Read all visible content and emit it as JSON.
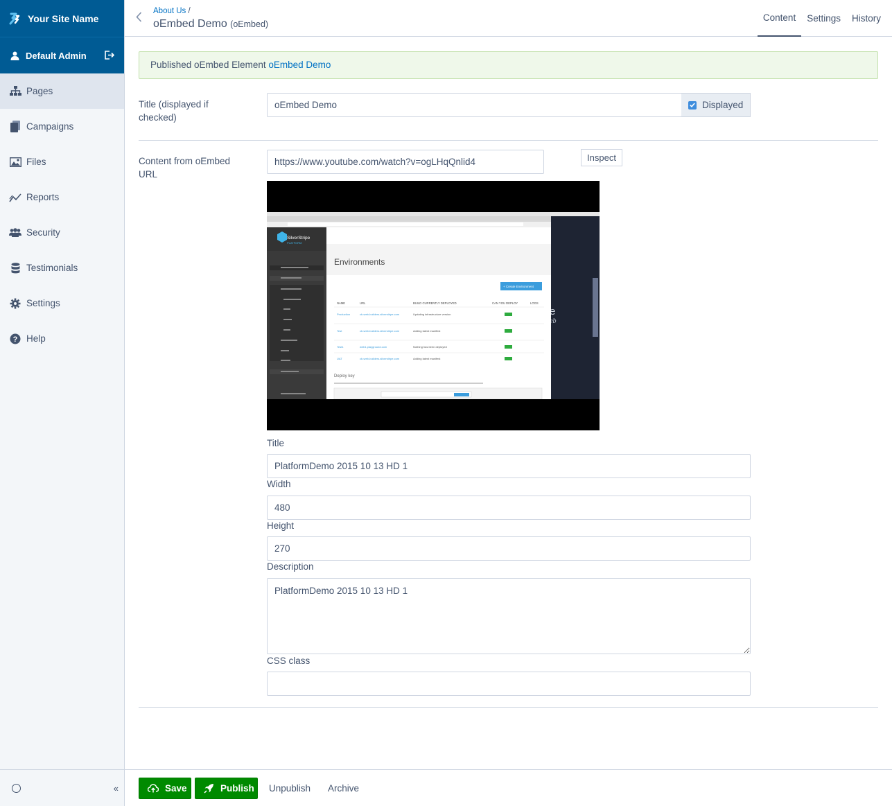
{
  "sidebar": {
    "brand": "Your Site Name",
    "user": "Default Admin",
    "items": [
      {
        "label": "Pages"
      },
      {
        "label": "Campaigns"
      },
      {
        "label": "Files"
      },
      {
        "label": "Reports"
      },
      {
        "label": "Security"
      },
      {
        "label": "Testimonials"
      },
      {
        "label": "Settings"
      },
      {
        "label": "Help"
      }
    ],
    "collapse_label": "«"
  },
  "header": {
    "breadcrumb": "About Us",
    "breadcrumb_sep": "/",
    "title": "oEmbed Demo",
    "type_label": "(oEmbed)",
    "tabs": [
      {
        "label": "Content"
      },
      {
        "label": "Settings"
      },
      {
        "label": "History"
      }
    ]
  },
  "message": {
    "text": "Published oEmbed Element",
    "link": "oEmbed Demo"
  },
  "form": {
    "title_label": "Title (displayed if checked)",
    "title_value": "oEmbed Demo",
    "displayed_label": "Displayed",
    "url_label": "Content from oEmbed URL",
    "url_value": "https://www.youtube.com/watch?v=ogLHqQnlid4",
    "inspect_label": "Inspect",
    "video": {
      "app_name": "SilverStripe",
      "app_sub": "PLATFORM",
      "heading": "Environments",
      "create_button": "+ Create Environment",
      "columns": [
        "NAME",
        "URL",
        "BUILD CURRENTLY DEPLOYED",
        "CAN YOU DEPLOY",
        "LOGS"
      ],
      "rows": [
        {
          "name": "Production",
          "url": "cb-web-builders.silverstripe.com",
          "build": "Updating infrastructure version"
        },
        {
          "name": "Test",
          "url": "cb-web-builders.silverstripe.com",
          "build": "Adding latest manifest"
        },
        {
          "name": "Test1",
          "url": "web1.playground.com",
          "build": "Nothing has been deployed"
        },
        {
          "name": "UAT",
          "url": "cb-web-builders.silverstripe.com",
          "build": "Adding latest manifest"
        }
      ],
      "deploy_key": "Deploy key"
    },
    "fields": {
      "title_label": "Title",
      "title_value": "PlatformDemo 2015 10 13 HD 1",
      "width_label": "Width",
      "width_value": "480",
      "height_label": "Height",
      "height_value": "270",
      "description_label": "Description",
      "description_value": "PlatformDemo 2015 10 13 HD 1",
      "css_label": "CSS class",
      "css_value": ""
    }
  },
  "footer": {
    "save": "Save",
    "publish": "Publish",
    "unpublish": "Unpublish",
    "archive": "Archive"
  },
  "colors": {
    "brand": "#005b94",
    "primary_action": "#008a00",
    "link": "#0071c4",
    "success_bg": "#eff8ea"
  }
}
